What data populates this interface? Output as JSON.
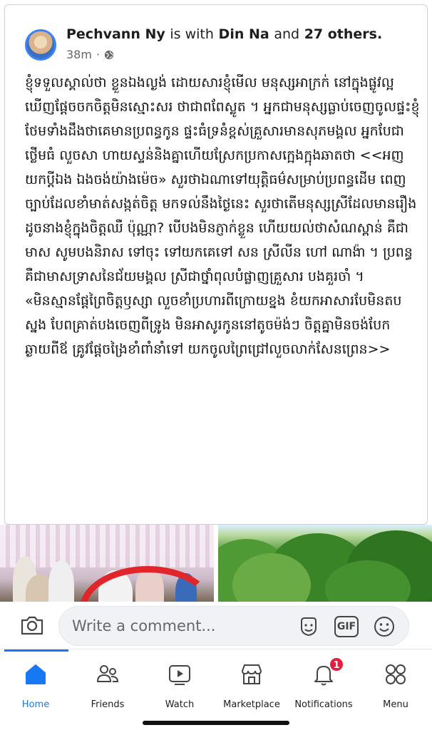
{
  "post": {
    "author": "Pechvann Ny",
    "with_text": "is with",
    "tagged": "Din Na",
    "and_text": "and",
    "others": "27 others.",
    "time": "38m",
    "paragraphs": [
      "ខ្ញុំទទួលស្គាល់ថា ខ្លួនឯងល្ងង់ ដោយសារខ្ញុំមើល មនុស្សអាក្រក់ នៅក្នុងផ្លូវល្អ ឃើញផ្ដែចចកចិត្តមិនស្មោះសរ ថាជាពពែស្លូត ។ អ្នកជាមនុស្សធ្លាប់ចេញចូលផ្ទះខ្ញុំ ថែមទាំងដឹងថាគេមានប្រពន្ធកូន ផ្ទះធំទ្រនំខ្ពស់គ្រួសារមានសុភមង្គល អ្នកបែជាថ្លើមធំ លួចសា ហាយស្ទន់និងគ្នាហើយស្រែកប្រកាសក្អេងក្អុងឆាតថា <<អញ យកប្ដីឯង ឯងចង់យ៉ាងម៉េច» សួរថាឯណាទៅយុត្តិធម៌សម្រាប់ប្រពន្ធដើម ពេញច្បាប់ដែលខាំមាត់សង្កត់ចិត្ត មកទល់នឹងថ្ងៃនេះ សួរថាតើមនុស្សស្រីដែលមានរឿងដូចនាងខ្ញុំក្នុងចិត្តឈឺ ប៉ុណ្ណា? បើបងមិនភ្ញាក់ខ្លួន ហើយយល់ថាសំណស្ពាន់ គឺជាមាស សូមបងនិរាស ទៅចុះ ទៅយកគេទៅ សន ស្រីលីន ហៅ ណាង៉ា ។ ប្រពន្ធគឺជាមាសទ្រាសនៃជ័យមង្គល ស្រីជាថ្នាំពុលបំផ្លាញគ្រួសារ បងគួរចាំ ។",
      "«មិនស្មានផ្ដែព្រៃចិត្តឫស្សា លួចខាំប្រហារពីក្រោយខ្នង ខំយកអាសារបែមិនតបស្នង បែពគ្រាត់បងចេញពីទ្រូង មិនអាសូរកូននៅតូចម៉ង់ៗ ចិត្តគ្នាមិនចង់បែកឆ្ងាយពីឪ គ្រូវផ្ដែចង្រៃខាំពាំនាំទៅ យកចូលព្រៃជ្រៅលួចលាក់សែនព្រេន>>"
    ]
  },
  "comment": {
    "placeholder": "Write a comment...",
    "gif_label": "GIF"
  },
  "tabs": [
    {
      "label": "Home",
      "icon": "home-icon",
      "active": true
    },
    {
      "label": "Friends",
      "icon": "friends-icon",
      "active": false
    },
    {
      "label": "Watch",
      "icon": "watch-icon",
      "active": false
    },
    {
      "label": "Marketplace",
      "icon": "marketplace-icon",
      "active": false
    },
    {
      "label": "Notifications",
      "icon": "bell-icon",
      "active": false,
      "badge": "1"
    },
    {
      "label": "Menu",
      "icon": "menu-grid-icon",
      "active": false
    }
  ],
  "colors": {
    "accent": "#1877f2",
    "badge": "#e41e3f",
    "secondary_text": "#65676b"
  }
}
